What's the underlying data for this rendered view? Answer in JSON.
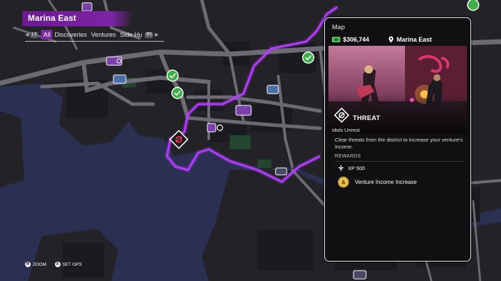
{
  "district": {
    "title": "Marina East"
  },
  "filters": {
    "left_button": "L1",
    "right_button": "R1",
    "tabs": [
      "All",
      "Discoveries",
      "Ventures",
      "Side Hu"
    ],
    "active_index": 0
  },
  "hints": [
    {
      "glyph": "R",
      "label": "ZOOM"
    },
    {
      "glyph": "X",
      "label": "SET GPS"
    }
  ],
  "panel": {
    "header": "Map",
    "money": "$306,744",
    "location": "Marina East",
    "activity_type": "THREAT",
    "activity_name": "Idols Unrest",
    "description": "Clear threats from the district to increase your venture's income.",
    "rewards_label": "REWARDS",
    "rewards": [
      {
        "icon": "fleur-de-lis-icon",
        "label": "XP 500"
      },
      {
        "icon": "gold-coin-icon",
        "label": "Venture Income Increase"
      }
    ]
  },
  "colors": {
    "accent_purple": "#7d24a6",
    "district_border": "#b43cff",
    "water": "#2b2f52",
    "land": "#242428",
    "road": "#6c6c74",
    "icon_green": "#3fae48"
  }
}
